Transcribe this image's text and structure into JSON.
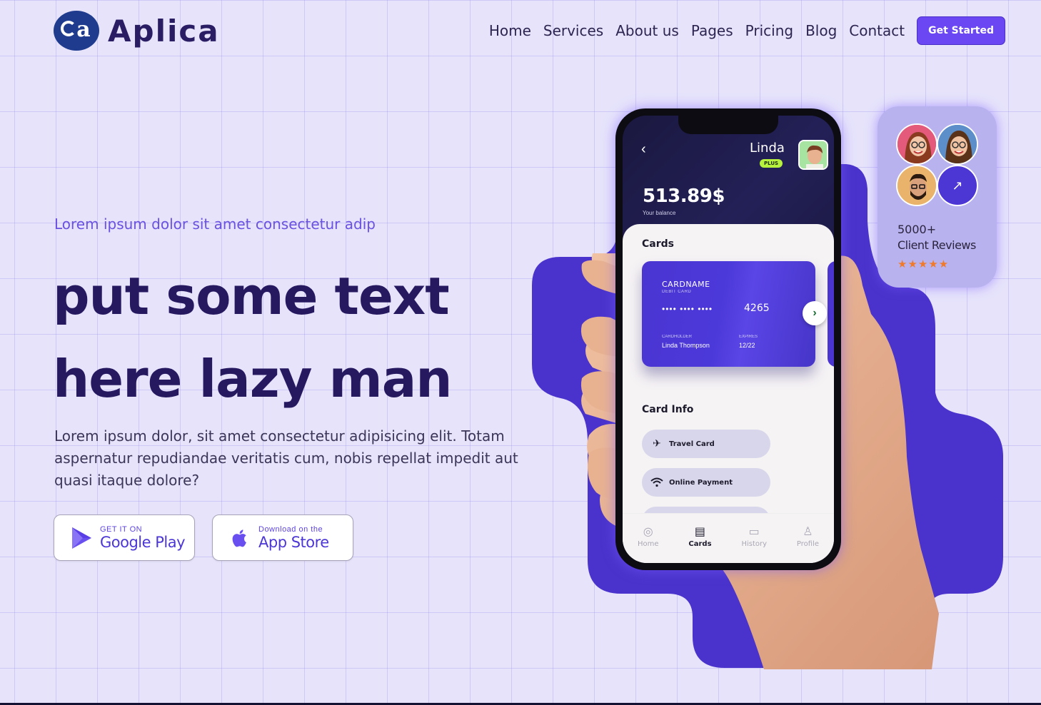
{
  "brand": {
    "logo_glyph": "a",
    "name": "Aplica"
  },
  "nav": {
    "items": [
      "Home",
      "Services",
      "About us",
      "Pages",
      "Pricing",
      "Blog",
      "Contact"
    ],
    "cta": "Get Started"
  },
  "hero": {
    "eyebrow": "Lorem ipsum dolor sit amet consectetur adip",
    "headline_line1": "put some text",
    "headline_line2": "here lazy man",
    "description": "Lorem ipsum dolor, sit amet consectetur adipisicing elit. Totam aspernatur repudiandae veritatis cum, nobis repellat impedit aut quasi itaque dolore?",
    "google_play": {
      "small": "GET IT ON",
      "big": "Google Play"
    },
    "app_store": {
      "small": "Download on the",
      "big": "App Store"
    }
  },
  "phone": {
    "user": "Linda",
    "badge": "PLUS",
    "balance": "513.89$",
    "balance_label": "Your balance",
    "cards_title": "Cards",
    "card": {
      "name": "CARDNAME",
      "type": "DEBIT CARD",
      "dots": "••••  ••••  ••••",
      "last4": "4265",
      "holder_label": "CARDHOLDER",
      "holder": "Linda Thompson",
      "expires_label": "EXPIRES",
      "expires": "12/22"
    },
    "card_info_title": "Card Info",
    "info_items": [
      {
        "icon": "plane-icon",
        "label": "Travel Card"
      },
      {
        "icon": "wifi-icon",
        "label": "Online Payment"
      }
    ],
    "tabs": [
      {
        "icon": "home-icon",
        "label": "Home"
      },
      {
        "icon": "cards-icon",
        "label": "Cards"
      },
      {
        "icon": "history-icon",
        "label": "History"
      },
      {
        "icon": "profile-icon",
        "label": "Profile"
      }
    ],
    "active_tab": "Cards"
  },
  "reviews": {
    "count": "5000+",
    "label": "Client Reviews",
    "stars": "★★★★★"
  },
  "colors": {
    "accent": "#6a47f2",
    "blob": "#4a33cc",
    "background": "#e6e3fb",
    "heading": "#271960"
  }
}
